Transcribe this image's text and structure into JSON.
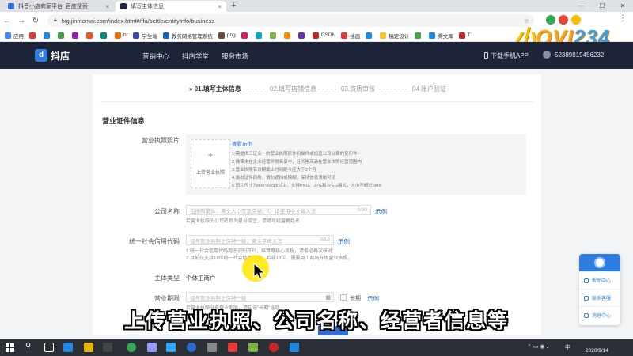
{
  "browser": {
    "tabs": [
      {
        "title": "抖音小店商家平台_百度搜索",
        "color": "#2f6fd6"
      },
      {
        "title": "填写主体信息",
        "color": "#1f2538",
        "active": true
      }
    ],
    "new_tab": "+",
    "url": "fxg.jinritemai.com/index.html#/ffa/settle/entityInfo/business",
    "bookmarks": [
      {
        "label": "应用",
        "color": "#4285f4"
      },
      {
        "label": "",
        "color": "#e53935"
      },
      {
        "label": "",
        "color": "#1e88e5"
      },
      {
        "label": "",
        "color": "#43a047"
      },
      {
        "label": "",
        "color": "#8e24aa"
      },
      {
        "label": "",
        "color": "#f4511e"
      },
      {
        "label": "",
        "color": "#00897b"
      },
      {
        "label": "bt",
        "color": "#ef6c00"
      },
      {
        "label": "学生端",
        "color": "#3949ab"
      },
      {
        "label": "教务网络管理系统",
        "color": "#1565c0"
      },
      {
        "label": "png",
        "color": "#6d4c41"
      },
      {
        "label": "",
        "color": "#d81b60"
      },
      {
        "label": "",
        "color": "#00acc1"
      },
      {
        "label": "",
        "color": "#7cb342"
      },
      {
        "label": "",
        "color": "#fb8c00"
      },
      {
        "label": "",
        "color": "#5e35b1"
      },
      {
        "label": "CSDN",
        "color": "#c62828"
      },
      {
        "label": "插画",
        "color": "#e53935"
      },
      {
        "label": "",
        "color": "#1e88e5"
      },
      {
        "label": "稿定设计",
        "color": "#fbc02d"
      },
      {
        "label": "",
        "color": "#43a047"
      },
      {
        "label": "腾文库",
        "color": "#1e88e5"
      },
      {
        "label": "T",
        "color": "#c62828"
      }
    ],
    "watermark": "小OVI234"
  },
  "header": {
    "logo_text": "抖店",
    "logo_glyph": "d",
    "nav": [
      "营销中心",
      "抖店学堂",
      "服务市场"
    ],
    "app_download": "下载手机APP",
    "user_id": "52389819456232"
  },
  "steps": [
    {
      "label": "01.填写主体信息",
      "prefix": "»",
      "active": true
    },
    {
      "label": "02.填写店铺信息"
    },
    {
      "label": "03.资质审核"
    },
    {
      "label": "04.账户验证"
    }
  ],
  "form": {
    "section_title": "营业证件信息",
    "license_label": "营业执照照片",
    "upload_label": "上传营业执照",
    "example_link": "查看示例",
    "tips": [
      "1.需提供三证合一的营业执照原件扫描件或加盖公司公章的复印件",
      "2.确保未在企业经营异常名录中，且所售商品在营业执照经营范围内",
      "3.营业执照有效期截止时间距今应大于3个月",
      "4.露出证件四角，请勿遮挡或模糊，保持信息清晰可见",
      "5.图片尺寸为800*800px以上，支持PNG、JPG和JPEG格式，大小不超过5MB"
    ],
    "company_label": "公司名称",
    "company_placeholder": "包括简繁体、英文大小写及空格、（）请使用中文输入法",
    "company_count": "0/30",
    "company_example": "示例",
    "company_hint": "若营业执照的公司名称为星号或空，请填写经营者姓名",
    "credit_label": "统一社会信用代码",
    "credit_placeholder": "请与营业执照上保持一致，英文字母大写",
    "credit_count": "0/18",
    "credit_example": "示例",
    "credit_hint_1": "1.统一社会信用代码用于识别开户，结算等核心流程，请务必再次核对;",
    "credit_hint_2": "2.目前仅支持18位统一社会信用代码，若非18位，需要到工商局升级营业执照。",
    "entity_type_label": "主体类型",
    "entity_type_value": "个体工商户",
    "term_label": "营业期限",
    "term_placeholder": "请与营业执照上保持一致",
    "term_long": "长期",
    "term_example": "示例",
    "term_hint": "若营业执照没有营业期限，请勾选\"长期\"选项"
  },
  "help_widget": {
    "items": [
      "帮助中心",
      "联系客服",
      "消息中心"
    ]
  },
  "subtitle": "上传营业执照、公司名称、经营者信息等",
  "taskbar": {
    "time": "2020/9/14",
    "lang": "中"
  }
}
